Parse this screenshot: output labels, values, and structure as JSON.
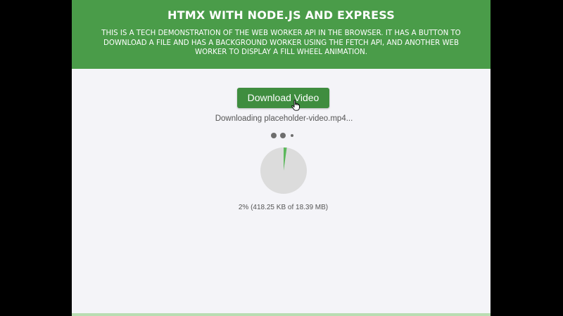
{
  "header": {
    "title": "HTMX WITH NODE.JS AND EXPRESS",
    "description": "This is a tech demonstration of the Web Worker API in the browser. It has a button to download a file and has a background worker using the Fetch API, and another Web Worker to display a fill wheel animation."
  },
  "main": {
    "download_button_label": "Download Video",
    "status_text": "Downloading placeholder-video.mp4...",
    "progress_text": "2% (418.25 KB of 18.39 MB)",
    "progress_fraction": 0.022,
    "cursor_icon": "pointer-hand-icon",
    "loader_icon": "loading-dots-icon"
  },
  "colors": {
    "header_bg": "#4a9c49",
    "button_bg": "#3f8d3f",
    "wheel_track": "#dcdcdc",
    "wheel_fill": "#5cb85c",
    "page_bg": "#f4f4f8"
  }
}
